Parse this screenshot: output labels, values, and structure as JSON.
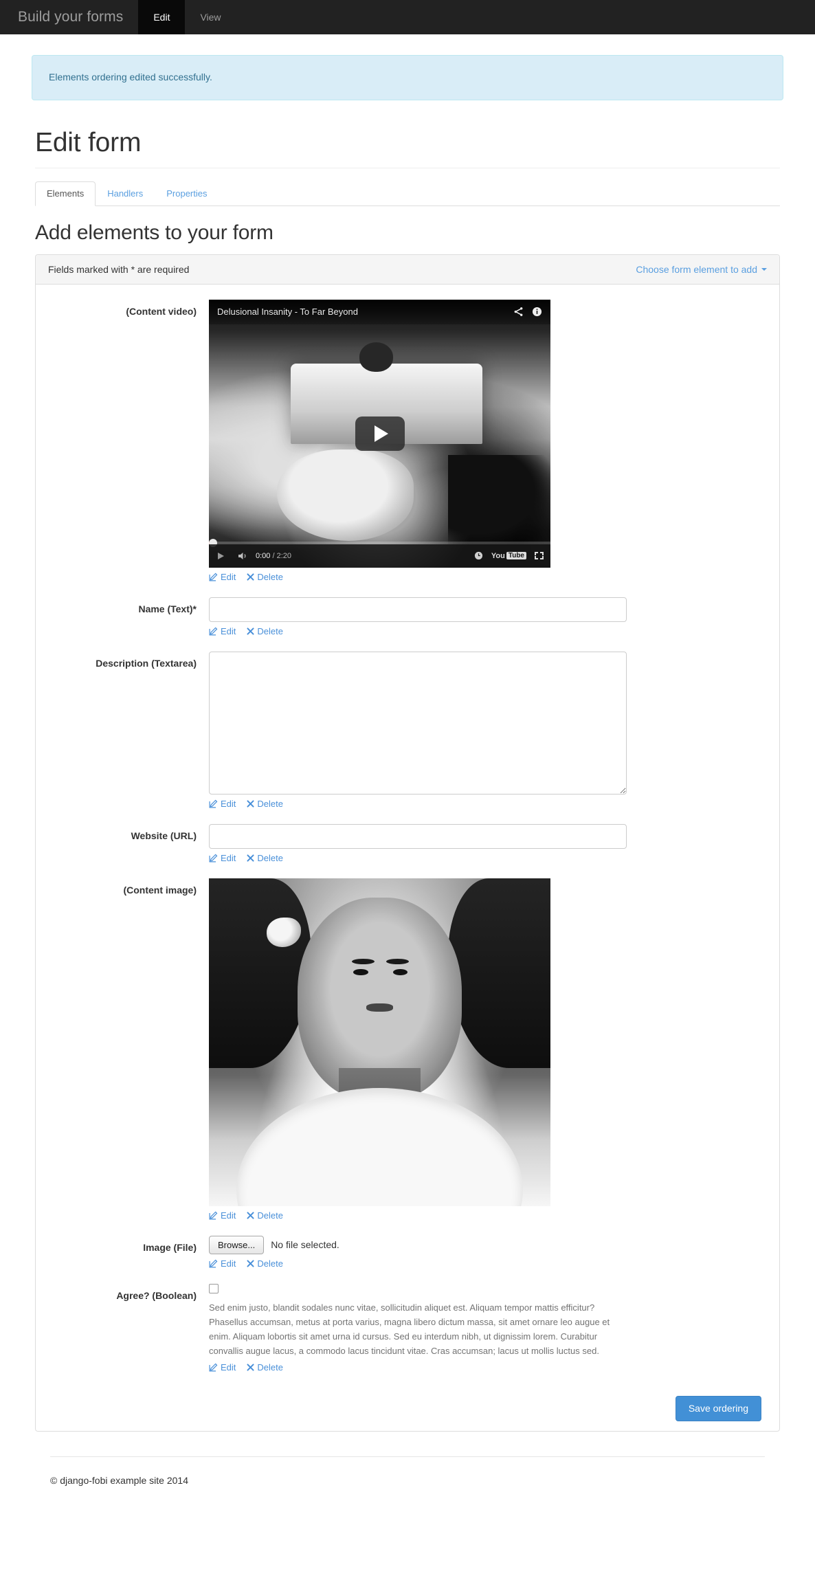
{
  "navbar": {
    "brand": "Build your forms",
    "items": [
      {
        "label": "Edit",
        "active": true
      },
      {
        "label": "View",
        "active": false
      }
    ]
  },
  "alert": {
    "message": "Elements ordering edited successfully."
  },
  "page": {
    "title": "Edit form"
  },
  "tabs": [
    {
      "label": "Elements",
      "active": true
    },
    {
      "label": "Handlers",
      "active": false
    },
    {
      "label": "Properties",
      "active": false
    }
  ],
  "section": {
    "title": "Add elements to your form"
  },
  "panel": {
    "required_note": "Fields marked with * are required",
    "dropdown_label": "Choose form element to add",
    "save_button": "Save ordering"
  },
  "actions": {
    "edit": "Edit",
    "delete": "Delete"
  },
  "video": {
    "title": "Delusional Insanity - To Far Beyond",
    "current_time": "0:00",
    "separator": " / ",
    "duration": "2:20",
    "brand": "You",
    "brand_box": "Tube"
  },
  "fields": [
    {
      "label": "(Content video)",
      "type": "video"
    },
    {
      "label": "Name (Text)*",
      "type": "text",
      "value": ""
    },
    {
      "label": "Description (Textarea)",
      "type": "textarea",
      "value": ""
    },
    {
      "label": "Website (URL)",
      "type": "url",
      "value": ""
    },
    {
      "label": "(Content image)",
      "type": "image"
    },
    {
      "label": "Image (File)",
      "type": "file",
      "button": "Browse...",
      "status": "No file selected."
    },
    {
      "label": "Agree? (Boolean)",
      "type": "checkbox",
      "checked": false,
      "help": "Sed enim justo, blandit sodales nunc vitae, sollicitudin aliquet est. Aliquam tempor mattis efficitur? Phasellus accumsan, metus at porta varius, magna libero dictum massa, sit amet ornare leo augue et enim. Aliquam lobortis sit amet urna id cursus. Sed eu interdum nibh, ut dignissim lorem. Curabitur convallis augue lacus, a commodo lacus tincidunt vitae. Cras accumsan; lacus ut mollis luctus sed."
    }
  ],
  "footer": {
    "copyright": "© django-fobi example site 2014"
  },
  "colors": {
    "navbar_bg": "#222222",
    "navbar_active_bg": "#090909",
    "link": "#4a90d9",
    "alert_bg": "#d9edf7",
    "alert_text": "#31708f",
    "primary": "#4290d6"
  }
}
